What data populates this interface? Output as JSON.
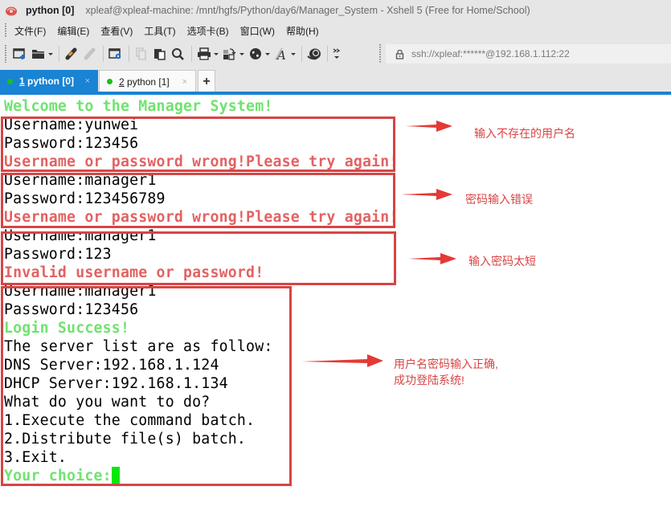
{
  "window": {
    "app_icon": "xshell-shell-icon",
    "title_main": "python [0]",
    "title_sub": "xpleaf@xpleaf-machine: /mnt/hgfs/Python/day6/Manager_System - Xshell 5 (Free for Home/School)"
  },
  "menu": {
    "items": [
      {
        "label": "文件(F)"
      },
      {
        "label": "编辑(E)"
      },
      {
        "label": "查看(V)"
      },
      {
        "label": "工具(T)"
      },
      {
        "label": "选项卡(B)"
      },
      {
        "label": "窗口(W)"
      },
      {
        "label": "帮助(H)"
      }
    ]
  },
  "toolbar": {
    "icons": [
      "new-session-icon",
      "open-folder-icon",
      "connect-icon",
      "disconnect-icon",
      "session-properties-icon",
      "copy-icon",
      "paste-icon",
      "find-icon",
      "print-icon",
      "transfer-icon",
      "globe-icon",
      "font-icon",
      "xftp-icon",
      "more-icon"
    ],
    "address": "ssh://xpleaf:******@192.168.1.112:22"
  },
  "tabs": [
    {
      "num": "1",
      "label": " python [0]",
      "close": "×",
      "active": true
    },
    {
      "num": "2",
      "label": " python [1]",
      "close": "×",
      "active": false
    }
  ],
  "tab_add_label": "+",
  "terminal": {
    "lines": [
      {
        "text": "Welcome to the Manager System!",
        "style": "green"
      },
      {
        "text": "Username:yunwei",
        "style": "normal"
      },
      {
        "text": "Password:123456",
        "style": "normal"
      },
      {
        "text": "Username or password wrong!Please try again!",
        "style": "red"
      },
      {
        "text": "Username:manager1",
        "style": "normal"
      },
      {
        "text": "Password:123456789",
        "style": "normal"
      },
      {
        "text": "Username or password wrong!Please try again!",
        "style": "red"
      },
      {
        "text": "Username:manager1",
        "style": "normal"
      },
      {
        "text": "Password:123",
        "style": "normal"
      },
      {
        "text": "Invalid username or password!",
        "style": "red"
      },
      {
        "text": "Username:manager1",
        "style": "normal"
      },
      {
        "text": "Password:123456",
        "style": "normal"
      },
      {
        "text": "Login Success!",
        "style": "green"
      },
      {
        "text": "The server list are as follow:",
        "style": "normal"
      },
      {
        "text": "DNS Server:192.168.1.124",
        "style": "normal"
      },
      {
        "text": "DHCP Server:192.168.1.134",
        "style": "normal"
      },
      {
        "text": "What do you want to do?",
        "style": "normal"
      },
      {
        "text": "1.Execute the command batch.",
        "style": "normal"
      },
      {
        "text": "2.Distribute file(s) batch.",
        "style": "normal"
      },
      {
        "text": "3.Exit.",
        "style": "normal"
      },
      {
        "text": "Your choice:",
        "style": "green"
      }
    ]
  },
  "annotations": [
    {
      "text": "输入不存在的用户名"
    },
    {
      "text": "密码输入错误"
    },
    {
      "text": "输入密码太短"
    },
    {
      "text_line1": "用户名密码输入正确,",
      "text_line2": "成功登陆系统!"
    }
  ],
  "colors": {
    "accent_tab": "#1983d4",
    "term_green": "#6fe36f",
    "term_red": "#e36262",
    "annotation_red": "#d64545",
    "cursor": "#08e808",
    "status_dot": "#17c217"
  }
}
